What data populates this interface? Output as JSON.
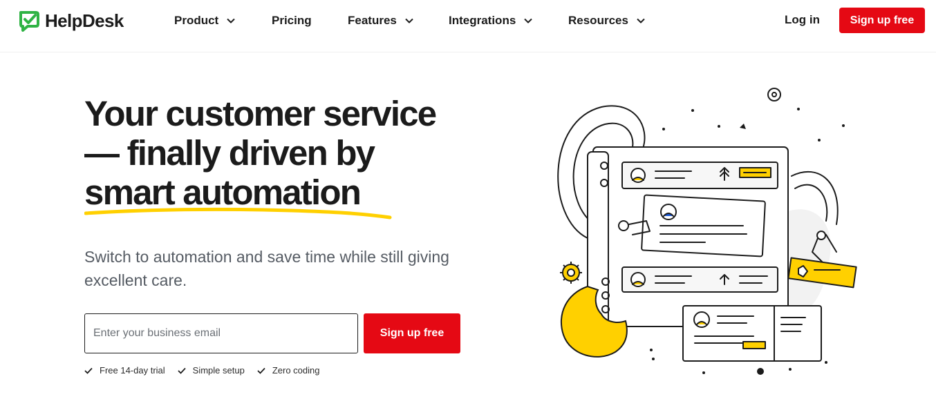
{
  "brand": {
    "name": "HelpDesk",
    "accent": "#e50914",
    "logo_color": "#2fb344"
  },
  "nav": {
    "items": [
      {
        "label": "Product",
        "has_dropdown": true
      },
      {
        "label": "Pricing",
        "has_dropdown": false
      },
      {
        "label": "Features",
        "has_dropdown": true
      },
      {
        "label": "Integrations",
        "has_dropdown": true
      },
      {
        "label": "Resources",
        "has_dropdown": true
      }
    ],
    "login": "Log in",
    "signup": "Sign up free"
  },
  "hero": {
    "title_line1": "Your customer service",
    "title_line2": "— finally driven by",
    "title_line3": "smart automation",
    "subtitle": "Switch to automation and save time while still giving excellent care.",
    "email_placeholder": "Enter your business email",
    "email_value": "",
    "cta": "Sign up free",
    "features": [
      "Free 14-day trial",
      "Simple setup",
      "Zero coding"
    ],
    "highlight_color": "#ffd000"
  }
}
